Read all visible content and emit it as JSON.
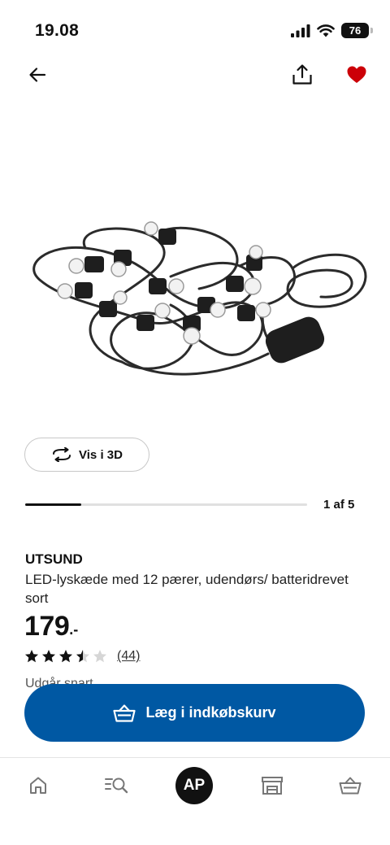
{
  "status_bar": {
    "time": "19.08",
    "battery": "76"
  },
  "top_nav": {
    "back_icon": "arrow-left-icon",
    "share_icon": "share-upload-icon",
    "favorite_icon": "heart-filled-icon",
    "favorite_color": "#cc0008"
  },
  "gallery": {
    "view_3d_label": "Vis i 3D",
    "view_3d_icon": "rotate-3d-icon",
    "current_index": 1,
    "total_images": 5,
    "position_label": "1 af 5"
  },
  "product": {
    "name": "UTSUND",
    "description": "LED-lyskæde med 12 pærer, udendørs/ batteridrevet sort",
    "price": "179",
    "price_suffix": ".-",
    "rating": 3.5,
    "rating_max": 5,
    "review_count": "(44)",
    "availability": "Udgår snart"
  },
  "cart": {
    "add_label": "Læg i indkøbskurv",
    "button_color": "#0058a3"
  },
  "bottom_nav": {
    "home_icon": "home-icon",
    "search_icon": "search-list-icon",
    "profile_initials": "AP",
    "stores_icon": "store-icon",
    "basket_icon": "basket-icon"
  }
}
